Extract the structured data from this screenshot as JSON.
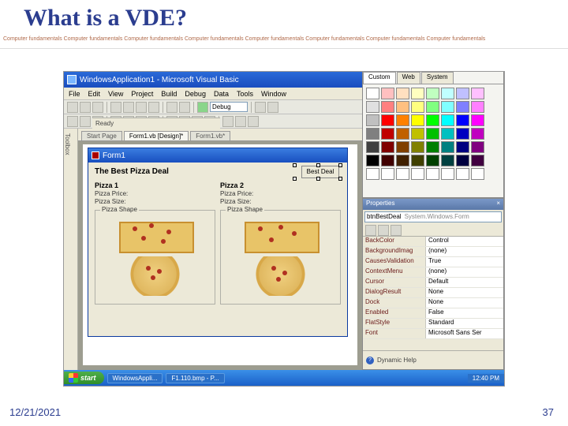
{
  "slide": {
    "title": "What is a VDE?",
    "tagline": "Computer fundamentals Computer fundamentals Computer fundamentals Computer fundamentals Computer fundamentals Computer fundamentals Computer fundamentals Computer fundamentals",
    "date": "12/21/2021",
    "page": "37"
  },
  "app": {
    "title": "WindowsApplication1 - Microsoft Visual Basic",
    "menus": [
      "File",
      "Edit",
      "View",
      "Project",
      "Build",
      "Debug",
      "Data",
      "Tools",
      "Window"
    ],
    "debug_combo": "Debug",
    "tabs": {
      "start": "Start Page",
      "design": "Form1.vb [Design]*",
      "code": "Form1.vb*"
    },
    "toolbox_label": "Toolbox"
  },
  "form": {
    "title": "Form1",
    "heading": "The Best Pizza Deal",
    "best_button": "Best Deal",
    "col1": {
      "name": "Pizza 1",
      "price": "Pizza Price:",
      "size": "Pizza Size:",
      "shape": "Pizza Shape"
    },
    "col2": {
      "name": "Pizza 2",
      "price": "Pizza Price:",
      "size": "Pizza Size:",
      "shape": "Pizza Shape"
    }
  },
  "colorpicker": {
    "tabs": [
      "Custom",
      "Web",
      "System"
    ],
    "colors": [
      "#ffffff",
      "#ffc0c0",
      "#ffe0c0",
      "#ffffc0",
      "#c0ffc0",
      "#c0ffff",
      "#c0c0ff",
      "#ffc0ff",
      "#e0e0e0",
      "#ff8080",
      "#ffc080",
      "#ffff80",
      "#80ff80",
      "#80ffff",
      "#8080ff",
      "#ff80ff",
      "#c0c0c0",
      "#ff0000",
      "#ff8000",
      "#ffff00",
      "#00ff00",
      "#00ffff",
      "#0000ff",
      "#ff00ff",
      "#808080",
      "#c00000",
      "#c06000",
      "#c0c000",
      "#00c000",
      "#00c0c0",
      "#0000c0",
      "#c000c0",
      "#404040",
      "#800000",
      "#804000",
      "#808000",
      "#008000",
      "#008080",
      "#000080",
      "#800080",
      "#000000",
      "#400000",
      "#402000",
      "#404000",
      "#004000",
      "#004040",
      "#000040",
      "#400040",
      "#ffffff",
      "#ffffff",
      "#ffffff",
      "#ffffff",
      "#ffffff",
      "#ffffff",
      "#ffffff",
      "#ffffff"
    ]
  },
  "props": {
    "panel_title": "Properties",
    "object": "btnBestDeal",
    "class": "System.Windows.Form",
    "rows": [
      {
        "n": "BackColor",
        "v": "Control"
      },
      {
        "n": "BackgroundImag",
        "v": "(none)"
      },
      {
        "n": "CausesValidation",
        "v": "True"
      },
      {
        "n": "ContextMenu",
        "v": "(none)"
      },
      {
        "n": "Cursor",
        "v": "Default"
      },
      {
        "n": "DialogResult",
        "v": "None"
      },
      {
        "n": "Dock",
        "v": "None"
      },
      {
        "n": "Enabled",
        "v": "False"
      },
      {
        "n": "FlatStyle",
        "v": "Standard"
      },
      {
        "n": "Font",
        "v": "Microsoft Sans Ser"
      }
    ],
    "help": "Dynamic Help"
  },
  "status": {
    "ready": "Ready",
    "start": "start",
    "task1": "WindowsAppli...",
    "task2": "F1.110.bmp - P...",
    "clock": "12:40 PM"
  }
}
